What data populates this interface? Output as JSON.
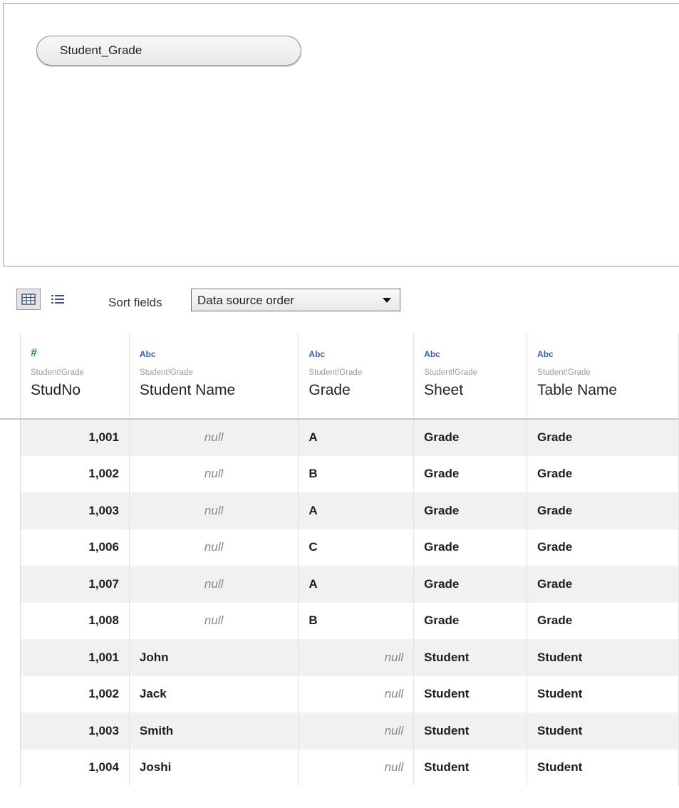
{
  "canvas": {
    "table_name": "Student_Grade"
  },
  "toolbar": {
    "sort_label": "Sort fields",
    "sort_value": "Data source order",
    "view_icons": [
      "grid-view-icon",
      "list-view-icon"
    ]
  },
  "columns": [
    {
      "type": "#",
      "source": "Student!Grade",
      "name": "StudNo"
    },
    {
      "type": "Abc",
      "source": "Student!Grade",
      "name": "Student Name"
    },
    {
      "type": "Abc",
      "source": "Student!Grade",
      "name": "Grade"
    },
    {
      "type": "Abc",
      "source": "Student!Grade",
      "name": "Sheet"
    },
    {
      "type": "Abc",
      "source": "Student!Grade",
      "name": "Table Name"
    }
  ],
  "rows": [
    [
      "1,001",
      "null",
      "A",
      "Grade",
      "Grade"
    ],
    [
      "1,002",
      "null",
      "B",
      "Grade",
      "Grade"
    ],
    [
      "1,003",
      "null",
      "A",
      "Grade",
      "Grade"
    ],
    [
      "1,006",
      "null",
      "C",
      "Grade",
      "Grade"
    ],
    [
      "1,007",
      "null",
      "A",
      "Grade",
      "Grade"
    ],
    [
      "1,008",
      "null",
      "B",
      "Grade",
      "Grade"
    ],
    [
      "1,001",
      "John",
      "null",
      "Student",
      "Student"
    ],
    [
      "1,002",
      "Jack",
      "null",
      "Student",
      "Student"
    ],
    [
      "1,003",
      "Smith",
      "null",
      "Student",
      "Student"
    ],
    [
      "1,004",
      "Joshi",
      "null",
      "Student",
      "Student"
    ]
  ],
  "colors": {
    "number_type": "#2e8b3a",
    "text_type": "#3c5ea8",
    "null_text": "#8a8a8a"
  }
}
